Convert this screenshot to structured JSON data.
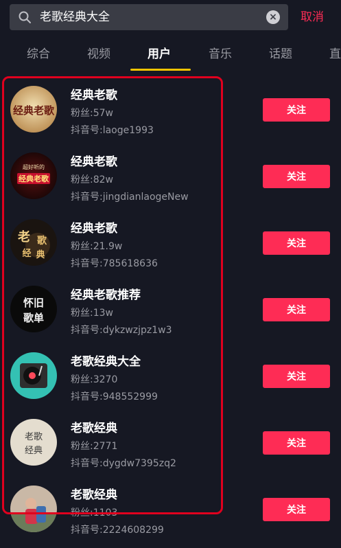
{
  "search": {
    "query": "老歌经典大全",
    "cancel_label": "取消"
  },
  "tabs": [
    {
      "label": "综合"
    },
    {
      "label": "视频"
    },
    {
      "label": "用户"
    },
    {
      "label": "音乐"
    },
    {
      "label": "话题"
    },
    {
      "label": "直"
    }
  ],
  "active_tab": "用户",
  "users": [
    {
      "name": "经典老歌",
      "fans": "粉丝:57w",
      "uid": "抖音号:laoge1993",
      "follow_label": "关注"
    },
    {
      "name": "经典老歌",
      "fans": "粉丝:82w",
      "uid": "抖音号:jingdianlaogeNew",
      "follow_label": "关注"
    },
    {
      "name": "经典老歌",
      "fans": "粉丝:21.9w",
      "uid": "抖音号:785618636",
      "follow_label": "关注"
    },
    {
      "name": "经典老歌推荐",
      "fans": "粉丝:13w",
      "uid": "抖音号:dykzwzjpz1w3",
      "follow_label": "关注"
    },
    {
      "name": "老歌经典大全",
      "fans": "粉丝:3270",
      "uid": "抖音号:948552999",
      "follow_label": "关注"
    },
    {
      "name": "老歌经典",
      "fans": "粉丝:2771",
      "uid": "抖音号:dygdw7395zq2",
      "follow_label": "关注"
    },
    {
      "name": "老歌经典",
      "fans": "粉丝:1103",
      "uid": "抖音号:2224608299",
      "follow_label": "关注"
    }
  ],
  "avatar_art": {
    "a1": "经典老歌",
    "a2_top": "超好听的",
    "a2_main": "经典老歌",
    "a3_1": "老",
    "a3_2": "歌",
    "a3_3": "经",
    "a3_4": "典",
    "a4_1": "怀旧",
    "a4_2": "歌单",
    "a6_1": "老歌",
    "a6_2": "经典"
  },
  "colors": {
    "accent": "#fe2c55",
    "tab_indicator": "#f5c400",
    "background": "#161823",
    "highlight": "#e0001e"
  }
}
